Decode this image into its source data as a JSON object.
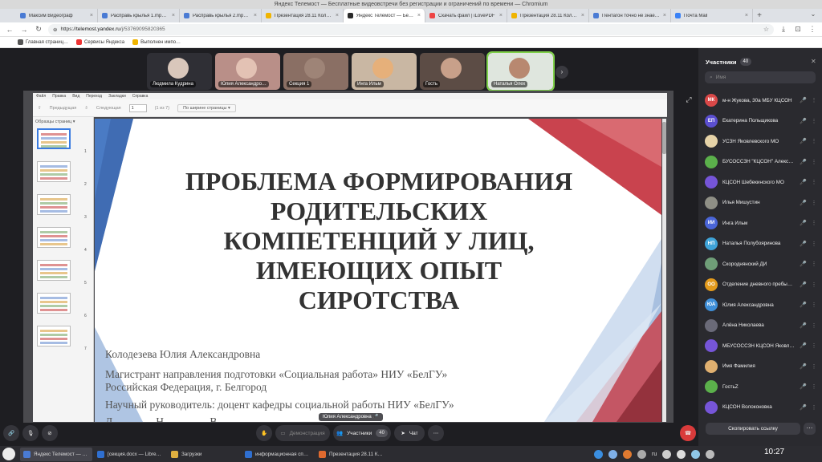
{
  "window": {
    "title": "Яндекс Телемост — Бесплатные видеовстречи без регистрации и ограничений по времени — Chromium"
  },
  "tabs": [
    {
      "label": "Максим Видеограф",
      "icon_color": "#4a7bd4"
    },
    {
      "label": "Расправь крылья 1.mp4 -…",
      "icon_color": "#4a7bd4"
    },
    {
      "label": "Расправь крылья 2.mp4 -…",
      "icon_color": "#4a7bd4"
    },
    {
      "label": "Презентация 28.11 Колод…",
      "icon_color": "#f0b400"
    },
    {
      "label": "Яндекс Телемост — Бес…",
      "icon_color": "#2a2a2a"
    },
    {
      "label": "Скачать файл | iLovePDF",
      "icon_color": "#e44"
    },
    {
      "label": "Презентация 28.11 Колод…",
      "icon_color": "#f0b400"
    },
    {
      "label": "Пентагон точно не знает, …",
      "icon_color": "#4a7bd4"
    },
    {
      "label": "Почта Mail",
      "icon_color": "#3b82f6"
    }
  ],
  "address": {
    "host": "telemost.yandex.ru",
    "path": "/j/53769095820365",
    "scheme": "https://"
  },
  "bookmarks": [
    {
      "label": "Главная страниц…",
      "icon_color": "#555"
    },
    {
      "label": "Сервисы Яндекса",
      "icon_color": "#e33"
    },
    {
      "label": "Выполнен импо…",
      "icon_color": "#f0b400"
    }
  ],
  "thumbnails": [
    {
      "name": "Людмила Кудрина",
      "bg": "#2f2f35",
      "face": "#d9c7bb",
      "active": false
    },
    {
      "name": "Юлия Александро…",
      "bg": "#b98f88",
      "face": "#e3c2b4",
      "active": false
    },
    {
      "name": "Секция 1",
      "bg": "#8a6f64",
      "face": "#9e8477",
      "active": false
    },
    {
      "name": "Инга Ильм",
      "bg": "#c9b7a3",
      "face": "#e6b07a",
      "active": false
    },
    {
      "name": "Гость",
      "bg": "#5c4c45",
      "face": "#c8a08a",
      "active": false
    },
    {
      "name": "Наталья Олех",
      "bg": "#dfe6de",
      "face": "#b88870",
      "active": true
    }
  ],
  "viewer": {
    "menu": [
      "Файл",
      "Правка",
      "Вид",
      "Переход",
      "Закладки",
      "Справка"
    ],
    "prev_label": "Предыдущая",
    "next_label": "Следующая",
    "page_value": "1",
    "page_total": "(1 из 7)",
    "zoom_label": "По ширине страницы ▾",
    "side_title": "Образцы страниц ▾",
    "slide_numbers": [
      "1",
      "2",
      "3",
      "4",
      "5",
      "6",
      "7"
    ]
  },
  "slide": {
    "title_lines": [
      "ПРОБЛЕМА ФОРМИРОВАНИЯ",
      "РОДИТЕЛЬСКИХ",
      "КОМПЕТЕНЦИЙ У ЛИЦ,",
      "ИМЕЮЩИХ ОПЫТ",
      "СИРОТСТВА"
    ],
    "lines": [
      "Колодезева Юлия Александровна",
      "Магистрант направления подготовки «Социальная работа» НИУ «БелГУ»",
      "Российская Федерация, г. Белгород",
      "Научный руководитель: доцент кафедры социальной работы НИУ «БелГУ»",
      "Д…………Н………… В……………"
    ]
  },
  "speaker": "Юлия Александровна",
  "controls": {
    "demo_label": "Демонстрация",
    "participants_label": "Участники",
    "participants_count": "40",
    "chat_label": "Чат"
  },
  "panel": {
    "title": "Участники",
    "count": "40",
    "search_placeholder": "Имя",
    "copy_link": "Скопировать ссылку",
    "participants": [
      {
        "initials": "МК",
        "name": "м-н Жукова, 30а МБУ КЦСОН",
        "color": "#d94848",
        "mic": "🎤"
      },
      {
        "initials": "ЕП",
        "name": "Екатерина Польщикова",
        "color": "#5b4fd0",
        "mic": "🎤"
      },
      {
        "initials": "",
        "name": "УСЗН Яковлевского МО",
        "color": "#e6d3a8",
        "mic": "🎤"
      },
      {
        "initials": "",
        "name": "БУСОССЗН \"КЦСОН\" Алекс…",
        "color": "#5bb04b",
        "mic": "🎤"
      },
      {
        "initials": "",
        "name": "КЦСОН Шебекинского МО",
        "color": "#7655d8",
        "mic": "🎤"
      },
      {
        "initials": "",
        "name": "Илья Мишустин",
        "color": "#8f8f86",
        "mic": "🎤"
      },
      {
        "initials": "ИИ",
        "name": "Инга Ильм",
        "color": "#4a65d8",
        "mic": "🎤"
      },
      {
        "initials": "НП",
        "name": "Наталья Полубояринова",
        "color": "#3fa3d8",
        "mic": "🎤"
      },
      {
        "initials": "",
        "name": "Скороднянский ДИ",
        "color": "#6f9e78",
        "mic": "🎤"
      },
      {
        "initials": "ОО",
        "name": "Отделение дневного пребы…",
        "color": "#e39a1c",
        "mic": "🎤"
      },
      {
        "initials": "ЮА",
        "name": "Юлия Александровна",
        "color": "#3f8fd8",
        "mic": "🎤"
      },
      {
        "initials": "",
        "name": "Алёна Николаева",
        "color": "#6a6a78",
        "mic": "🎤"
      },
      {
        "initials": "",
        "name": "МБУСОССЗН КЦСОН Яковл…",
        "color": "#7655d8",
        "mic": "🎤"
      },
      {
        "initials": "",
        "name": "Имя Фамилия",
        "color": "#e0b070",
        "mic": "🎤"
      },
      {
        "initials": "",
        "name": "ГостьZ",
        "color": "#5bb04b",
        "mic": "🎤"
      },
      {
        "initials": "",
        "name": "КЦСОН Волоконовка",
        "color": "#7655d8",
        "mic": "🎤"
      }
    ]
  },
  "taskbar": {
    "tasks": [
      {
        "label": "Яндекс Телемост — Бесп…",
        "icon_color": "#4a7bd4",
        "active": true
      },
      {
        "label": "[секция.docx — LibreOff…",
        "icon_color": "#2f6fd0",
        "active": false
      },
      {
        "label": "Загрузки",
        "icon_color": "#e0b040",
        "active": false
      },
      {
        "label": "информационная справ…",
        "icon_color": "#2f6fd0",
        "active": false
      },
      {
        "label": "Презентация 28.11 Коло…",
        "icon_color": "#e06a2f",
        "active": false
      }
    ],
    "lang": "ru",
    "time": "10:27"
  }
}
